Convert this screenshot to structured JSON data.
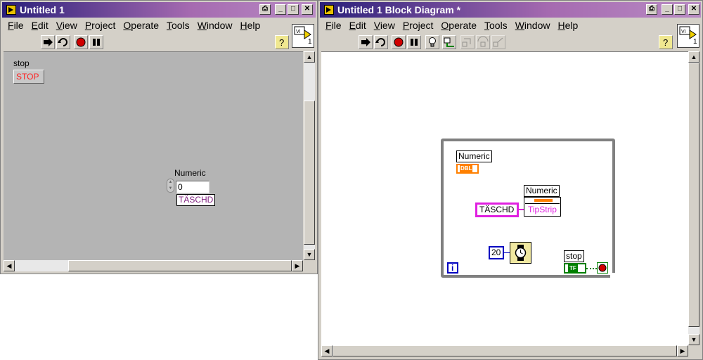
{
  "front_panel": {
    "title": "Untitled 1",
    "menu": [
      "File",
      "Edit",
      "View",
      "Project",
      "Operate",
      "Tools",
      "Window",
      "Help"
    ],
    "stop_label": "stop",
    "stop_button_text": "STOP",
    "numeric_label": "Numeric",
    "numeric_value": "0",
    "tipstrip_text": "TÄSCHD",
    "vi_icon_number": "1"
  },
  "block_diagram": {
    "title": "Untitled 1 Block Diagram *",
    "menu": [
      "File",
      "Edit",
      "View",
      "Project",
      "Operate",
      "Tools",
      "Window",
      "Help"
    ],
    "numeric_terminal_label": "Numeric",
    "numeric_terminal_type": "DBL",
    "property_node_label": "Numeric",
    "string_constant": "TÄSCHD",
    "property_name": "TipStrip",
    "wait_constant": "20",
    "stop_terminal_label": "stop",
    "stop_terminal_type": "TF",
    "iteration_terminal": "i",
    "vi_icon_number": "1"
  },
  "colors": {
    "title_start": "#2a1f7a",
    "title_end": "#b98bc4",
    "panel_bg": "#b4b4b4",
    "diagram_bg": "#ffffff",
    "string_wire": "#e020e0",
    "dbl_orange": "#ff8000",
    "bool_green": "#008000",
    "int_blue": "#0000c0"
  }
}
